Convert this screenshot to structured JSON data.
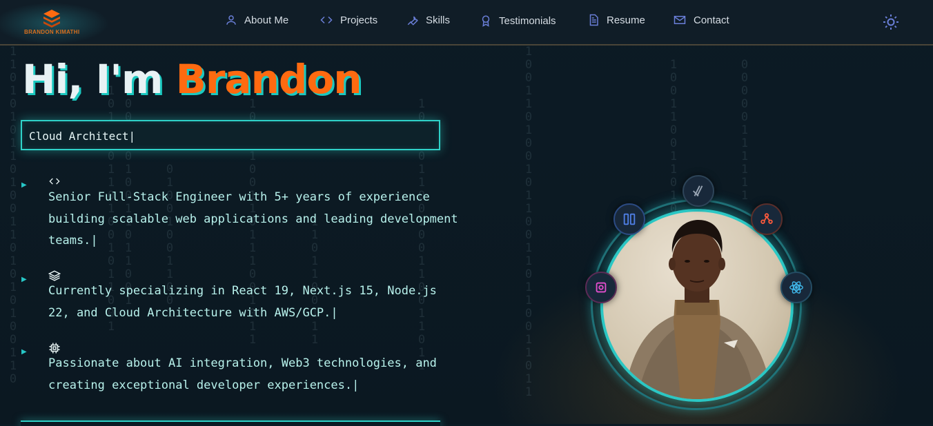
{
  "logo": {
    "text": "BRANDON KIMATHI",
    "icon": "layers-logo-icon"
  },
  "nav": {
    "items": [
      {
        "label": "About Me",
        "icon": "user-icon"
      },
      {
        "label": "Projects",
        "icon": "code-brackets-icon"
      },
      {
        "label": "Skills",
        "icon": "wrench-icon"
      },
      {
        "label": "Testimonials",
        "icon": "award-icon"
      },
      {
        "label": "Resume",
        "icon": "document-icon"
      },
      {
        "label": "Contact",
        "icon": "mail-icon"
      }
    ],
    "theme_toggle_icon": "sun-icon"
  },
  "hero": {
    "greeting": "Hi, I'm",
    "name": "Brandon",
    "role": "Cloud Architect|",
    "bullets": [
      {
        "icon": "code-brackets-icon",
        "text": "Senior Full-Stack Engineer with 5+ years of experience building scalable web applications and leading development teams.|"
      },
      {
        "icon": "layers-icon",
        "text": "Currently specializing in React 19, Next.js 15, Node.js 22, and Cloud Architecture with AWS/GCP.|"
      },
      {
        "icon": "cpu-chip-icon",
        "text": "Passionate about AI integration, Web3 technologies, and creating exceptional developer experiences.|"
      }
    ]
  },
  "avatar": {
    "orbit_icons": [
      "chakra-icon",
      "split-panel-icon",
      "git-branch-icon",
      "gear-box-icon",
      "react-icon"
    ]
  },
  "colors": {
    "accent": "#2fd2c8",
    "brand_orange": "#ff6a10",
    "background": "#0b1a24",
    "nav_text": "#d6dde4",
    "nav_icon": "#6a7fd8"
  }
}
